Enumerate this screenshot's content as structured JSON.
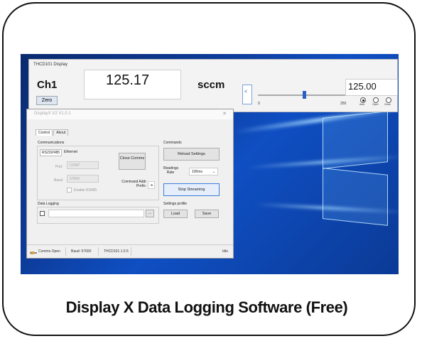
{
  "caption": "Display X Data Logging Software (Free)",
  "display": {
    "window_title": "THCD101 Display",
    "channel": "Ch1",
    "zero_label": "Zero",
    "reading": "125.17",
    "unit": "sccm",
    "slider_arrow": "<",
    "slider_min": "0",
    "slider_max": "250",
    "slider_level_fraction": 0.5,
    "setpoint": "125.00",
    "modes": [
      "Auto",
      "Open",
      "Close"
    ],
    "selected_mode": "Auto"
  },
  "settings": {
    "window_title": "DisplayX V2 V1.0.1",
    "close_glyph": "✕",
    "tabs": [
      "Control",
      "About"
    ],
    "communications_label": "Communications",
    "comm_tabs": [
      "RS232/485",
      "Ethernet"
    ],
    "port_label": "Port:",
    "port_value": "COM7",
    "baud_label": "Baud:",
    "baud_value": "57600",
    "enable_rs485": "Enable RS485",
    "close_comms": "Close Comms",
    "command_prefix_label": "Command Addr Prefix:",
    "command_prefix_value": "a",
    "commands_label": "Commands",
    "reload_settings": "Reload Settings",
    "readings_rate_label": "Readings Rate",
    "readings_rate_value": "100ms",
    "stop_streaming": "Stop Streaming",
    "settings_profile_label": "Settings profile",
    "load": "Load",
    "save": "Save",
    "data_logging_label": "Data Logging",
    "browse": "...",
    "status": {
      "comms": "Comms Open",
      "baud": "Baud: 57600",
      "device": "THCD101 1.0.5",
      "state": "Idle"
    }
  },
  "colors": {
    "desktop_blue": "#0d3c9a",
    "accent": "#2a60c8",
    "highlight_border": "#3c7fd8"
  }
}
